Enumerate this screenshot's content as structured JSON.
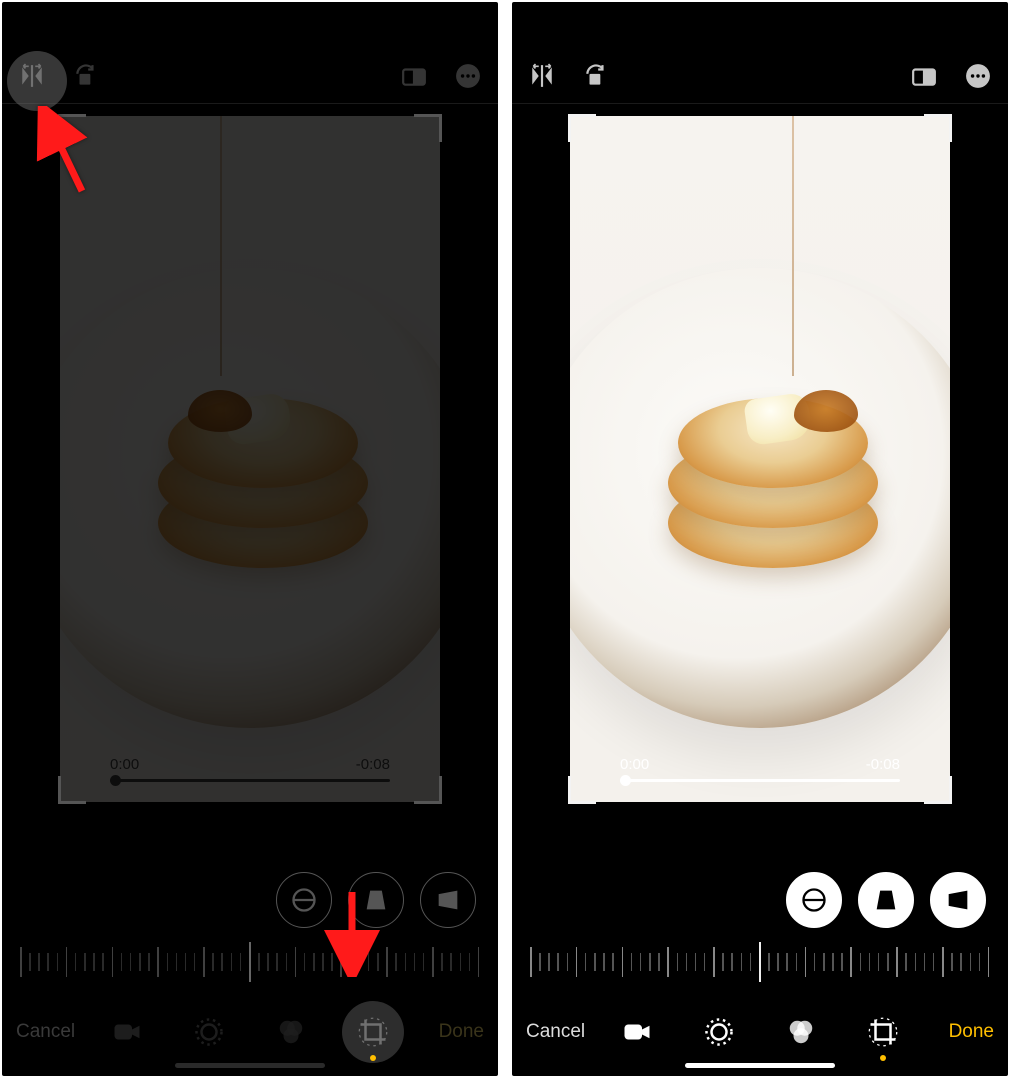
{
  "left": {
    "scrubber": {
      "start": "0:00",
      "end": "-0:08"
    },
    "bottom": {
      "cancel": "Cancel",
      "done": "Done"
    },
    "active_perspective": 0,
    "active_tool": "crop"
  },
  "right": {
    "scrubber": {
      "start": "0:00",
      "end": "-0:08"
    },
    "bottom": {
      "cancel": "Cancel",
      "done": "Done"
    },
    "active_perspective": 0,
    "active_tool": "crop"
  },
  "icons": {
    "flip": "flip-horizontal-icon",
    "rotate": "rotate-icon",
    "aspect": "aspect-ratio-icon",
    "more": "more-icon",
    "straighten": "straighten-icon",
    "vertical": "perspective-vertical-icon",
    "horizontal": "perspective-horizontal-icon",
    "video": "video-icon",
    "adjust": "adjust-icon",
    "filters": "filters-icon",
    "crop": "crop-icon"
  },
  "colors": {
    "accent": "#ffbf00",
    "arrow": "#ff1a1a"
  }
}
